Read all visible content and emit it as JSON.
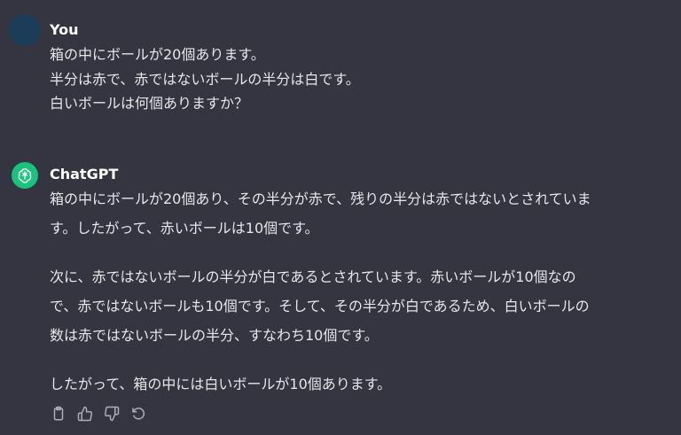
{
  "user": {
    "name": "You",
    "lines": [
      "箱の中にボールが20個あります。",
      "半分は赤で、赤ではないボールの半分は白です。",
      "白いボールは何個ありますか？"
    ]
  },
  "assistant": {
    "name": "ChatGPT",
    "lines": [
      "箱の中にボールが20個あり、その半分が赤で、残りの半分は赤ではないとされていま",
      "す。したがって、赤いボールは10個です。",
      "次に、赤ではないボールの半分が白であるとされています。赤いボールが10個なの",
      "で、赤ではないボールも10個です。そして、その半分が白であるため、白いボールの",
      "数は赤ではないボールの半分、すなわち10個です。",
      "したがって、箱の中には白いボールが10個あります。"
    ]
  },
  "actions": [
    "copy-icon",
    "thumbs-up-icon",
    "thumbs-down-icon",
    "regenerate-icon"
  ],
  "colors": {
    "background": "#343541",
    "text": "#ececf1",
    "user_avatar": "#1c3d58",
    "assistant_avatar": "#19c37d",
    "icon": "#acacbe"
  }
}
